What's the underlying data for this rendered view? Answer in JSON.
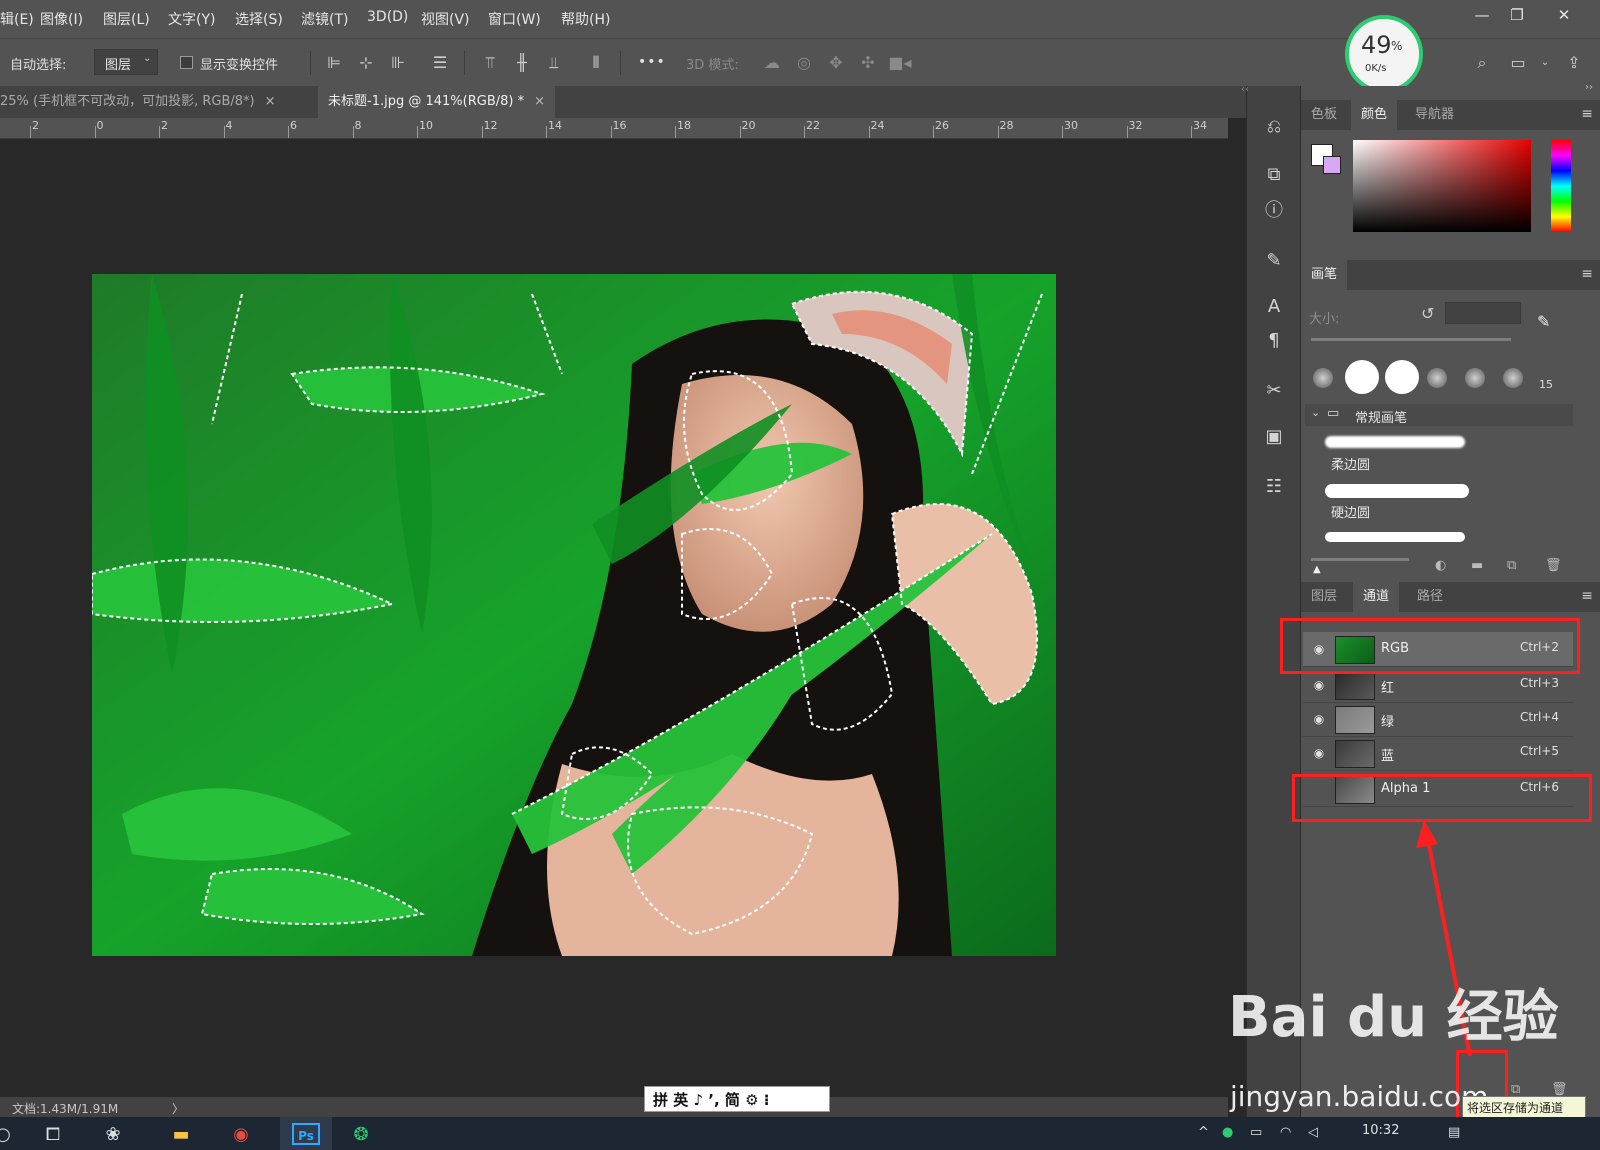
{
  "menu": {
    "items": [
      "辑(E)",
      "图像(I)",
      "图层(L)",
      "文字(Y)",
      "选择(S)",
      "滤镜(T)",
      "3D(D)",
      "视图(V)",
      "窗口(W)",
      "帮助(H)"
    ]
  },
  "window_controls": {
    "minimize": "—",
    "restore": "❐",
    "close": "✕"
  },
  "perf_widget": {
    "percent": "49",
    "percent_sign": "%",
    "speed": "0K/s"
  },
  "options_bar": {
    "auto_select_label": "自动选择:",
    "auto_select_value": "图层",
    "show_transform_label": "显示变换控件",
    "more_label": "•••",
    "mode_3d_label": "3D 模式:"
  },
  "tabs": [
    {
      "label": "25% (手机框不可改动，可加投影, RGB/8*)",
      "close": "×"
    },
    {
      "label": "未标题-1.jpg @ 141%(RGB/8) *",
      "close": "×"
    }
  ],
  "ruler": {
    "numbers": [
      "2",
      "0",
      "2",
      "4",
      "6",
      "8",
      "10",
      "12",
      "14",
      "16",
      "18",
      "20",
      "22",
      "24",
      "26",
      "28",
      "30",
      "32",
      "34"
    ]
  },
  "status_bar": {
    "doc_info": "文档:1.43M/1.91M",
    "arrow": "〉"
  },
  "ime_bar": {
    "text": "拼 英 ♪ ’, 简 ⚙ ⁝"
  },
  "color_panel": {
    "tabs": [
      "色板",
      "颜色",
      "导航器"
    ],
    "active_tab": "颜色"
  },
  "brush_panel": {
    "tab": "画笔",
    "size_label": "大小:",
    "preset_count": "15",
    "group_name": "常规画笔",
    "brushes": [
      "柔边圆",
      "硬边圆"
    ]
  },
  "channels_panel": {
    "tabs": [
      "图层",
      "通道",
      "路径"
    ],
    "active_tab": "通道",
    "channels": [
      {
        "name": "RGB",
        "shortcut": "Ctrl+2",
        "visible": true
      },
      {
        "name": "红",
        "shortcut": "Ctrl+3",
        "visible": true
      },
      {
        "name": "绿",
        "shortcut": "Ctrl+4",
        "visible": true
      },
      {
        "name": "蓝",
        "shortcut": "Ctrl+5",
        "visible": true
      },
      {
        "name": "Alpha 1",
        "shortcut": "Ctrl+6",
        "visible": false
      }
    ],
    "tooltip": "将选区存储为通道"
  },
  "watermark": {
    "logo": "Bai du 经验",
    "url": "jingyan.baidu.com"
  },
  "taskbar": {
    "time": "10:32",
    "tray_up": "^"
  },
  "colors": {
    "highlight": "#ff1f1f",
    "perf_green": "#2ecc71",
    "ps_blue": "#31a8ff"
  }
}
